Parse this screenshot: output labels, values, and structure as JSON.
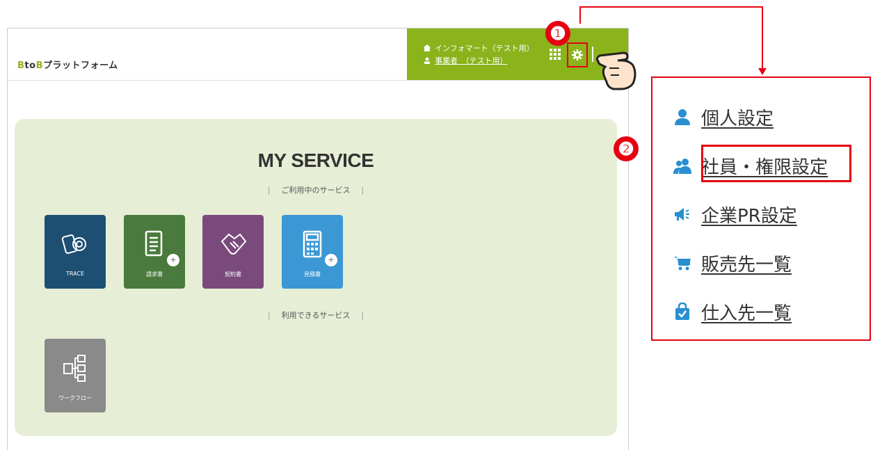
{
  "header": {
    "logo_text": "BtoBプラットフォーム",
    "company": "インフォマート（テスト用）",
    "user": "事業者　（テスト用）"
  },
  "main": {
    "title": "MY SERVICE",
    "section_in_use": "ご利用中のサービス",
    "section_available": "利用できるサービス",
    "tiles_in_use": [
      {
        "label": "TRACE",
        "color": "#1d4f73",
        "icon": "gears-icon"
      },
      {
        "label": "請求書",
        "color": "#4a7a3d",
        "icon": "document-icon"
      },
      {
        "label": "契約書",
        "color": "#7a4a7d",
        "icon": "handshake-icon"
      },
      {
        "label": "見積書",
        "color": "#3b98d4",
        "icon": "calculator-icon"
      }
    ],
    "tiles_available": [
      {
        "label": "ワークフロー",
        "color": "#8a8a8a",
        "icon": "workflow-icon"
      }
    ]
  },
  "annotations": {
    "step1": "❶",
    "step2": "❷",
    "accent": "#e60012"
  },
  "settings_menu": {
    "items": [
      {
        "label": "個人設定",
        "icon": "person-icon"
      },
      {
        "label": "社員・権限設定",
        "icon": "people-icon"
      },
      {
        "label": "企業PR設定",
        "icon": "megaphone-icon"
      },
      {
        "label": "販売先一覧",
        "icon": "cart-icon"
      },
      {
        "label": "仕入先一覧",
        "icon": "bag-lock-icon"
      }
    ]
  }
}
